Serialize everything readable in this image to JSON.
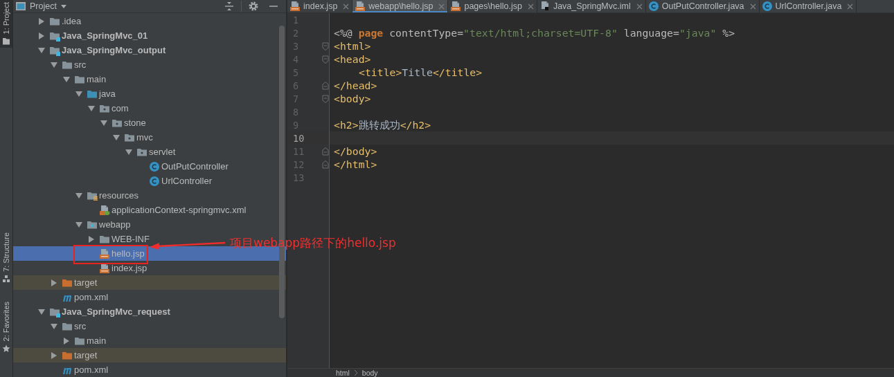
{
  "tool_stripe": [
    {
      "label": "1: Project",
      "selected": true
    },
    {
      "label": "7: Structure",
      "selected": false
    },
    {
      "label": "2: Favorites",
      "selected": false
    }
  ],
  "project_panel": {
    "title": "Project"
  },
  "tree": {
    "items": [
      {
        "label": ".idea",
        "kind": "folder",
        "expanded": false,
        "selected": false
      },
      {
        "label": "Java_SpringMvc_01",
        "kind": "module",
        "expanded": false,
        "selected": false
      },
      {
        "label": "Java_SpringMvc_output",
        "kind": "module",
        "expanded": true,
        "selected": false,
        "children": [
          {
            "label": "src",
            "kind": "folder",
            "expanded": true,
            "selected": false,
            "children": [
              {
                "label": "main",
                "kind": "folder",
                "expanded": true,
                "selected": false,
                "children": [
                  {
                    "label": "java",
                    "kind": "source-folder",
                    "expanded": true,
                    "selected": false,
                    "children": [
                      {
                        "label": "com",
                        "kind": "package",
                        "expanded": true,
                        "selected": false,
                        "children": [
                          {
                            "label": "stone",
                            "kind": "package",
                            "expanded": true,
                            "selected": false,
                            "children": [
                              {
                                "label": "mvc",
                                "kind": "package",
                                "expanded": true,
                                "selected": false,
                                "children": [
                                  {
                                    "label": "servlet",
                                    "kind": "package",
                                    "expanded": true,
                                    "selected": false,
                                    "children": [
                                      {
                                        "label": "OutPutController",
                                        "kind": "class",
                                        "selected": false
                                      },
                                      {
                                        "label": "UrlController",
                                        "kind": "class",
                                        "selected": false
                                      }
                                    ]
                                  }
                                ]
                              }
                            ]
                          }
                        ]
                      }
                    ]
                  },
                  {
                    "label": "resources",
                    "kind": "resources",
                    "expanded": true,
                    "selected": false,
                    "children": [
                      {
                        "label": "applicationContext-springmvc.xml",
                        "kind": "xml",
                        "selected": false
                      }
                    ]
                  },
                  {
                    "label": "webapp",
                    "kind": "web",
                    "expanded": true,
                    "selected": false,
                    "children": [
                      {
                        "label": "WEB-INF",
                        "kind": "folder",
                        "expanded": false,
                        "selected": false
                      },
                      {
                        "label": "hello.jsp",
                        "kind": "jsp",
                        "selected": true
                      },
                      {
                        "label": "index.jsp",
                        "kind": "jsp",
                        "selected": false
                      }
                    ]
                  }
                ]
              }
            ]
          },
          {
            "label": "target",
            "kind": "excluded",
            "expanded": false,
            "selected": false
          },
          {
            "label": "pom.xml",
            "kind": "maven",
            "selected": false
          }
        ]
      },
      {
        "label": "Java_SpringMvc_request",
        "kind": "module",
        "expanded": true,
        "selected": false,
        "children": [
          {
            "label": "src",
            "kind": "folder",
            "expanded": true,
            "selected": false,
            "children": [
              {
                "label": "main",
                "kind": "folder",
                "expanded": false,
                "selected": false
              }
            ]
          },
          {
            "label": "target",
            "kind": "excluded",
            "expanded": false,
            "selected": false
          },
          {
            "label": "pom.xml",
            "kind": "maven",
            "selected": false
          }
        ]
      }
    ]
  },
  "tabs": [
    {
      "label": "index.jsp",
      "kind": "jsp",
      "selected": false
    },
    {
      "label": "webapp\\hello.jsp",
      "kind": "jsp",
      "selected": true
    },
    {
      "label": "pages\\hello.jsp",
      "kind": "jsp",
      "selected": false
    },
    {
      "label": "Java_SpringMvc.iml",
      "kind": "iml",
      "selected": false
    },
    {
      "label": "OutPutController.java",
      "kind": "class",
      "selected": false
    },
    {
      "label": "UrlController.java",
      "kind": "class",
      "selected": false
    }
  ],
  "code": {
    "lines": [
      {
        "number": "1",
        "kind": "plain",
        "current": false
      },
      {
        "number": "2",
        "kind": "plain",
        "current": false,
        "tokens": [
          {
            "kind": "plain",
            "text": "<%@ "
          },
          {
            "kind": "keyword",
            "text": "page"
          },
          {
            "kind": "attr",
            "text": " contentType="
          },
          {
            "kind": "string",
            "text": "\"text/html;charset=UTF-8\""
          },
          {
            "kind": "attr",
            "text": " language="
          },
          {
            "kind": "string",
            "text": "\"java\""
          },
          {
            "kind": "plain",
            "text": " %>"
          }
        ]
      },
      {
        "number": "3",
        "kind": "fold-start",
        "current": false,
        "tokens": [
          {
            "kind": "tag",
            "text": "<html>"
          }
        ]
      },
      {
        "number": "4",
        "kind": "fold-start",
        "current": false,
        "tokens": [
          {
            "kind": "tag",
            "text": "<head>"
          }
        ]
      },
      {
        "number": "5",
        "kind": "indented",
        "current": false,
        "tokens": [
          {
            "kind": "tag",
            "text": "<title>"
          },
          {
            "kind": "text",
            "text": "Title"
          },
          {
            "kind": "tag",
            "text": "</title>"
          }
        ]
      },
      {
        "number": "6",
        "kind": "fold-end",
        "current": false,
        "tokens": [
          {
            "kind": "tag",
            "text": "</head>"
          }
        ]
      },
      {
        "number": "7",
        "kind": "fold-start",
        "current": false,
        "tokens": [
          {
            "kind": "tag",
            "text": "<body>"
          }
        ]
      },
      {
        "number": "8",
        "kind": "plain",
        "current": false
      },
      {
        "number": "9",
        "kind": "plain",
        "current": false,
        "tokens": [
          {
            "kind": "tag",
            "text": "<h2>"
          },
          {
            "kind": "text",
            "text": "跳转成功"
          },
          {
            "kind": "tag",
            "text": "</h2>"
          }
        ]
      },
      {
        "number": "10",
        "kind": "plain",
        "current": true
      },
      {
        "number": "11",
        "kind": "fold-end",
        "current": false,
        "tokens": [
          {
            "kind": "tag",
            "text": "</body>"
          }
        ]
      },
      {
        "number": "12",
        "kind": "fold-end",
        "current": false,
        "tokens": [
          {
            "kind": "tag",
            "text": "</html>"
          }
        ]
      },
      {
        "number": "13",
        "kind": "plain",
        "current": false
      }
    ]
  },
  "breadcrumbs": [
    "html",
    "body"
  ],
  "annotation": {
    "text": "项目webapp路径下的hello.jsp"
  }
}
